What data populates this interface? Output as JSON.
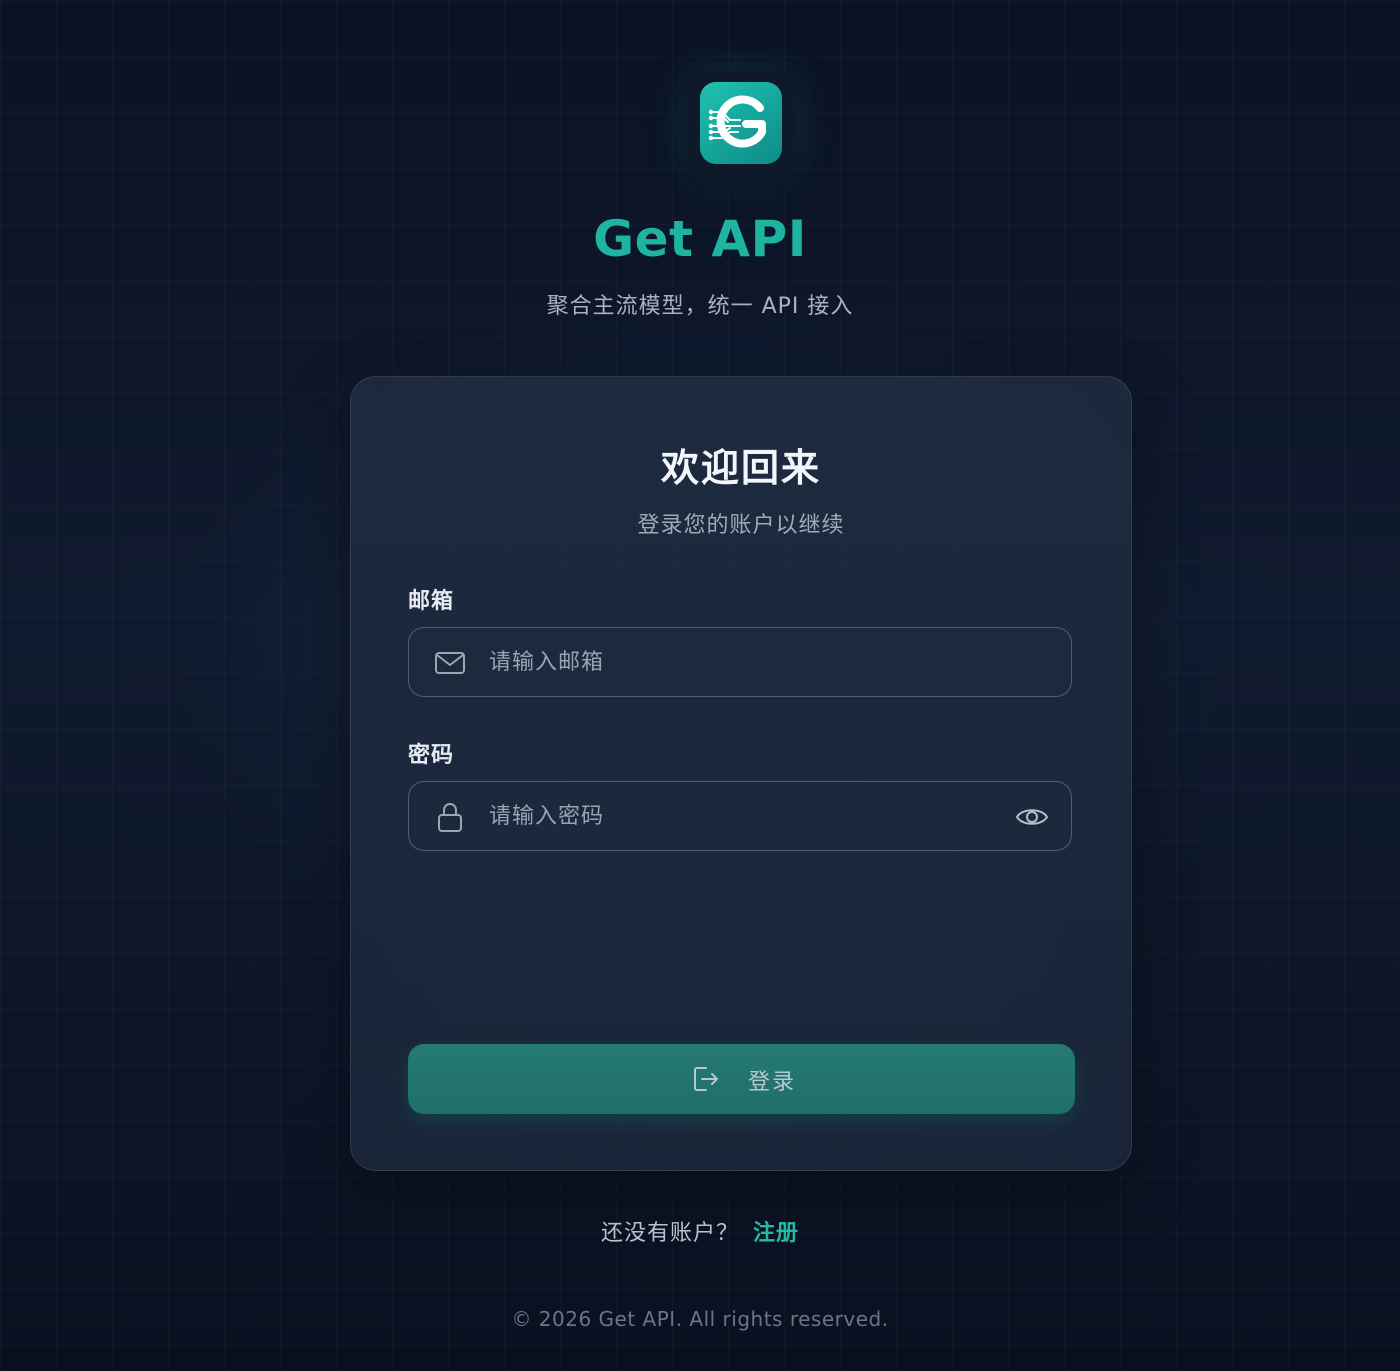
{
  "brand": {
    "name": "Get API",
    "tagline": "聚合主流模型，统一 API 接入",
    "accent_color": "#1fb3a1",
    "logo_icon": "circuit-g-icon"
  },
  "login_card": {
    "title": "欢迎回来",
    "subtitle": "登录您的账户以继续",
    "email": {
      "label": "邮箱",
      "placeholder": "请输入邮箱",
      "value": "",
      "icon": "mail-icon"
    },
    "password": {
      "label": "密码",
      "placeholder": "请输入密码",
      "value": "",
      "icon": "lock-icon",
      "toggle_icon": "eye-icon"
    },
    "submit": {
      "label": "登录",
      "icon": "login-icon",
      "color": "#277a74"
    }
  },
  "signup": {
    "prompt": "还没有账户？",
    "link_label": "注册"
  },
  "footer": {
    "copyright": "© 2026 Get API. All rights reserved."
  }
}
